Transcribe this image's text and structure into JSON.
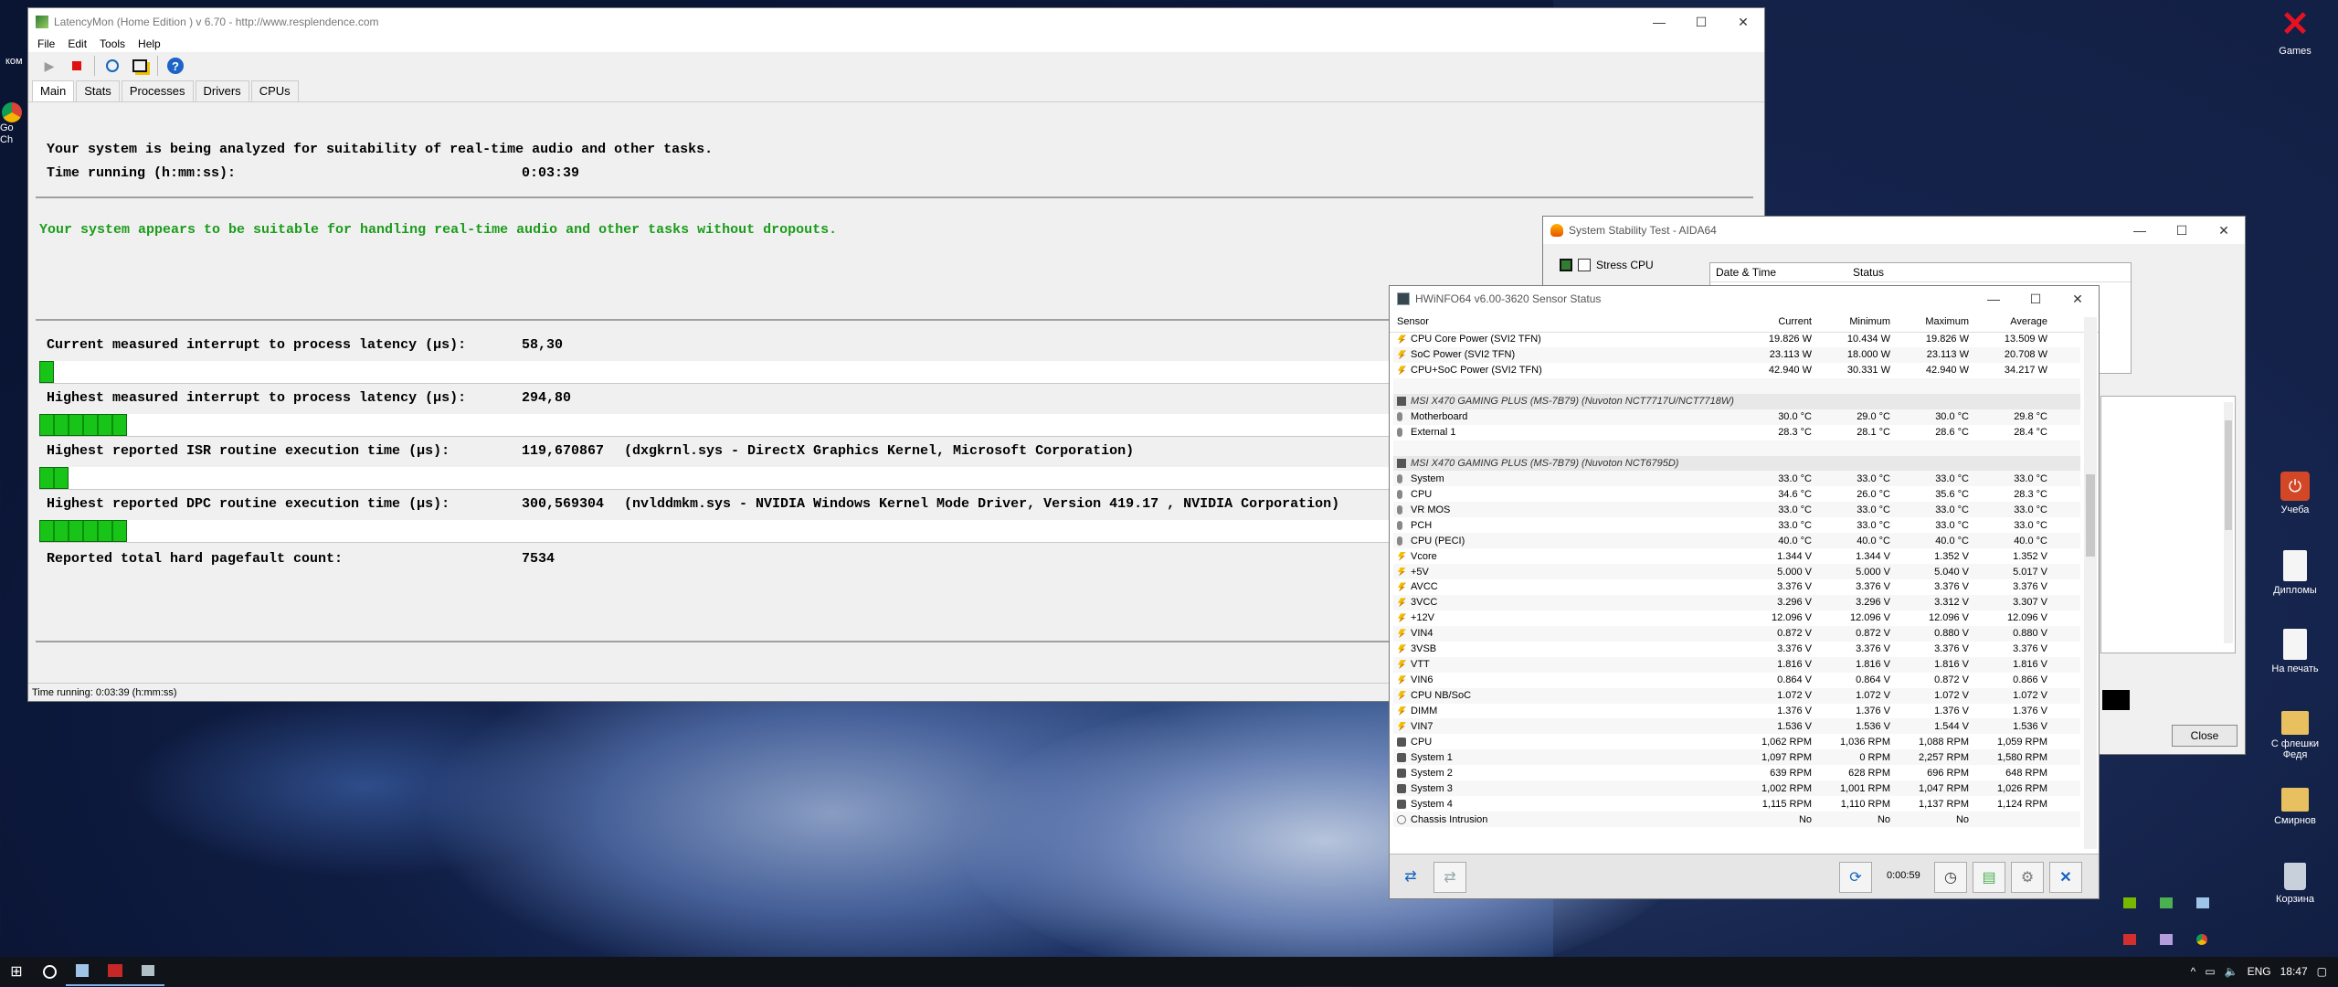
{
  "latencymon": {
    "title": "LatencyMon  (Home Edition )  v 6.70 - http://www.resplendence.com",
    "menu": [
      "File",
      "Edit",
      "Tools",
      "Help"
    ],
    "tabs": [
      "Main",
      "Stats",
      "Processes",
      "Drivers",
      "CPUs"
    ],
    "heading1": "Your system is being analyzed for suitability of real-time audio and other tasks.",
    "time_label": "Time running (h:mm:ss):",
    "time_value": "0:03:39",
    "verdict": "Your system appears to be suitable for handling real-time audio and other tasks without dropouts.",
    "metrics": [
      {
        "label": "Current measured interrupt to process latency (µs):",
        "value": "58,30",
        "detail": "",
        "bar_fraction": 0.006
      },
      {
        "label": "Highest measured interrupt to process latency (µs):",
        "value": "294,80",
        "detail": "",
        "bar_fraction": 0.055
      },
      {
        "label": "Highest reported ISR routine execution time (µs):",
        "value": "119,670867",
        "detail": "(dxgkrnl.sys - DirectX Graphics Kernel, Microsoft Corporation)",
        "bar_fraction": 0.021
      },
      {
        "label": "Highest reported DPC routine execution time (µs):",
        "value": "300,569304",
        "detail": "(nvlddmkm.sys - NVIDIA Windows Kernel Mode Driver, Version 419.17 , NVIDIA Corporation)",
        "bar_fraction": 0.05
      }
    ],
    "pagefault_label": "Reported total hard pagefault count:",
    "pagefault_value": "7534",
    "status": "Time running: 0:03:39  (h:mm:ss)"
  },
  "aida": {
    "title": "System Stability Test - AIDA64",
    "stress_cpu": "Stress CPU",
    "col_date": "Date & Time",
    "col_status": "Status",
    "close": "Close"
  },
  "hwinfo": {
    "title": "HWiNFO64 v6.00-3620 Sensor Status",
    "columns": [
      "Sensor",
      "Current",
      "Minimum",
      "Maximum",
      "Average"
    ],
    "timer": "0:00:59",
    "rows": [
      {
        "type": "bolt",
        "name": "CPU Core Power (SVI2 TFN)",
        "cur": "19.826 W",
        "min": "10.434 W",
        "max": "19.826 W",
        "avg": "13.509 W"
      },
      {
        "type": "bolt",
        "name": "SoC Power (SVI2 TFN)",
        "cur": "23.113 W",
        "min": "18.000 W",
        "max": "23.113 W",
        "avg": "20.708 W"
      },
      {
        "type": "bolt",
        "name": "CPU+SoC Power (SVI2 TFN)",
        "cur": "42.940 W",
        "min": "30.331 W",
        "max": "42.940 W",
        "avg": "34.217 W"
      },
      {
        "type": "blank",
        "name": "",
        "cur": "",
        "min": "",
        "max": "",
        "avg": ""
      },
      {
        "type": "group",
        "name": "MSI X470 GAMING PLUS (MS-7B79) (Nuvoton NCT7717U/NCT7718W)",
        "cur": "",
        "min": "",
        "max": "",
        "avg": ""
      },
      {
        "type": "therm",
        "name": "Motherboard",
        "cur": "30.0 °C",
        "min": "29.0 °C",
        "max": "30.0 °C",
        "avg": "29.8 °C"
      },
      {
        "type": "therm",
        "name": "External 1",
        "cur": "28.3 °C",
        "min": "28.1 °C",
        "max": "28.6 °C",
        "avg": "28.4 °C"
      },
      {
        "type": "blank",
        "name": "",
        "cur": "",
        "min": "",
        "max": "",
        "avg": ""
      },
      {
        "type": "group",
        "name": "MSI X470 GAMING PLUS (MS-7B79) (Nuvoton NCT6795D)",
        "cur": "",
        "min": "",
        "max": "",
        "avg": ""
      },
      {
        "type": "therm",
        "name": "System",
        "cur": "33.0 °C",
        "min": "33.0 °C",
        "max": "33.0 °C",
        "avg": "33.0 °C"
      },
      {
        "type": "therm",
        "name": "CPU",
        "cur": "34.6 °C",
        "min": "26.0 °C",
        "max": "35.6 °C",
        "avg": "28.3 °C"
      },
      {
        "type": "therm",
        "name": "VR MOS",
        "cur": "33.0 °C",
        "min": "33.0 °C",
        "max": "33.0 °C",
        "avg": "33.0 °C"
      },
      {
        "type": "therm",
        "name": "PCH",
        "cur": "33.0 °C",
        "min": "33.0 °C",
        "max": "33.0 °C",
        "avg": "33.0 °C"
      },
      {
        "type": "therm",
        "name": "CPU (PECI)",
        "cur": "40.0 °C",
        "min": "40.0 °C",
        "max": "40.0 °C",
        "avg": "40.0 °C"
      },
      {
        "type": "bolt",
        "name": "Vcore",
        "cur": "1.344 V",
        "min": "1.344 V",
        "max": "1.352 V",
        "avg": "1.352 V"
      },
      {
        "type": "bolt",
        "name": "+5V",
        "cur": "5.000 V",
        "min": "5.000 V",
        "max": "5.040 V",
        "avg": "5.017 V"
      },
      {
        "type": "bolt",
        "name": "AVCC",
        "cur": "3.376 V",
        "min": "3.376 V",
        "max": "3.376 V",
        "avg": "3.376 V"
      },
      {
        "type": "bolt",
        "name": "3VCC",
        "cur": "3.296 V",
        "min": "3.296 V",
        "max": "3.312 V",
        "avg": "3.307 V"
      },
      {
        "type": "bolt",
        "name": "+12V",
        "cur": "12.096 V",
        "min": "12.096 V",
        "max": "12.096 V",
        "avg": "12.096 V"
      },
      {
        "type": "bolt",
        "name": "VIN4",
        "cur": "0.872 V",
        "min": "0.872 V",
        "max": "0.880 V",
        "avg": "0.880 V"
      },
      {
        "type": "bolt",
        "name": "3VSB",
        "cur": "3.376 V",
        "min": "3.376 V",
        "max": "3.376 V",
        "avg": "3.376 V"
      },
      {
        "type": "bolt",
        "name": "VTT",
        "cur": "1.816 V",
        "min": "1.816 V",
        "max": "1.816 V",
        "avg": "1.816 V"
      },
      {
        "type": "bolt",
        "name": "VIN6",
        "cur": "0.864 V",
        "min": "0.864 V",
        "max": "0.872 V",
        "avg": "0.866 V"
      },
      {
        "type": "bolt",
        "name": "CPU NB/SoC",
        "cur": "1.072 V",
        "min": "1.072 V",
        "max": "1.072 V",
        "avg": "1.072 V"
      },
      {
        "type": "bolt",
        "name": "DIMM",
        "cur": "1.376 V",
        "min": "1.376 V",
        "max": "1.376 V",
        "avg": "1.376 V"
      },
      {
        "type": "bolt",
        "name": "VIN7",
        "cur": "1.536 V",
        "min": "1.536 V",
        "max": "1.544 V",
        "avg": "1.536 V"
      },
      {
        "type": "fan",
        "name": "CPU",
        "cur": "1,062 RPM",
        "min": "1,036 RPM",
        "max": "1,088 RPM",
        "avg": "1,059 RPM"
      },
      {
        "type": "fan",
        "name": "System 1",
        "cur": "1,097 RPM",
        "min": "0 RPM",
        "max": "2,257 RPM",
        "avg": "1,580 RPM"
      },
      {
        "type": "fan",
        "name": "System 2",
        "cur": "639 RPM",
        "min": "628 RPM",
        "max": "696 RPM",
        "avg": "648 RPM"
      },
      {
        "type": "fan",
        "name": "System 3",
        "cur": "1,002 RPM",
        "min": "1,001 RPM",
        "max": "1,047 RPM",
        "avg": "1,026 RPM"
      },
      {
        "type": "fan",
        "name": "System 4",
        "cur": "1,115 RPM",
        "min": "1,110 RPM",
        "max": "1,137 RPM",
        "avg": "1,124 RPM"
      },
      {
        "type": "intr",
        "name": "Chassis Intrusion",
        "cur": "No",
        "min": "No",
        "max": "No",
        "avg": ""
      }
    ]
  },
  "desktop": {
    "icons": [
      "Games",
      "Учеба",
      "Дипломы",
      "На печать",
      "С флешки Федя",
      "Смирнов",
      "Корзина"
    ],
    "left_partial": [
      "ком",
      "Go",
      "Ch"
    ]
  },
  "taskbar": {
    "lang": "ENG",
    "time": "18:47"
  },
  "colors": {
    "accent_green": "#1a9c1a",
    "bar_green": "#18c418",
    "close_red": "#e81123"
  }
}
